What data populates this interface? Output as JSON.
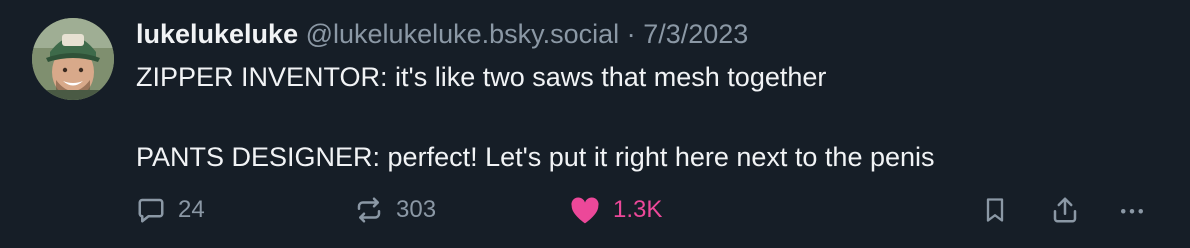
{
  "post": {
    "author": {
      "display_name": "lukelukeluke",
      "handle": "@lukelukeluke.bsky.social"
    },
    "separator": "·",
    "date": "7/3/2023",
    "text": {
      "line1": "ZIPPER INVENTOR: it's like two saws that mesh together",
      "line2": "PANTS DESIGNER: perfect! Let's put it right here next to the penis"
    },
    "counts": {
      "replies": "24",
      "reposts": "303",
      "likes": "1.3K"
    },
    "liked": true
  },
  "icons": {
    "reply": "speech-bubble-icon",
    "repost": "repost-arrows-icon",
    "like": "heart-icon",
    "bookmark": "bookmark-icon",
    "share": "share-upload-icon",
    "more": "ellipsis-icon"
  },
  "colors": {
    "background": "#161e27",
    "text": "#f1f3f5",
    "muted": "#8b98a5",
    "like_accent": "#ec4899"
  }
}
